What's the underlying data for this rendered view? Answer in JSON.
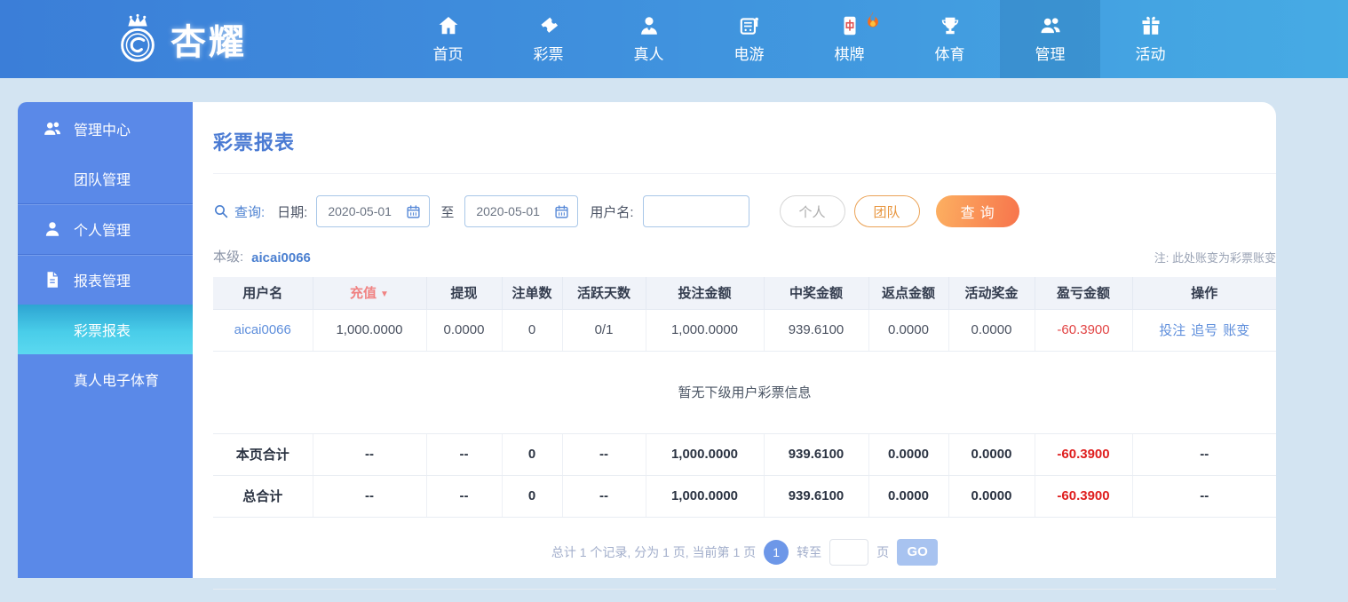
{
  "brand": {
    "name": "杏耀"
  },
  "nav": {
    "items": [
      {
        "id": "home",
        "label": "首页",
        "icon": "home-icon"
      },
      {
        "id": "lottery",
        "label": "彩票",
        "icon": "ticket-icon"
      },
      {
        "id": "live",
        "label": "真人",
        "icon": "dealer-icon"
      },
      {
        "id": "egames",
        "label": "电游",
        "icon": "slot-machine-icon"
      },
      {
        "id": "boardgames",
        "label": "棋牌",
        "icon": "mahjong-icon",
        "hot": true
      },
      {
        "id": "sports",
        "label": "体育",
        "icon": "trophy-icon"
      },
      {
        "id": "manage",
        "label": "管理",
        "icon": "group-icon",
        "active": true
      },
      {
        "id": "activity",
        "label": "活动",
        "icon": "gift-icon"
      }
    ]
  },
  "sidebar": {
    "items": [
      {
        "id": "manage-center",
        "label": "管理中心",
        "icon": "group-icon",
        "type": "parent"
      },
      {
        "id": "team-manage",
        "label": "团队管理",
        "type": "child"
      },
      {
        "id": "personal-manage",
        "label": "个人管理",
        "icon": "user-icon",
        "type": "parent",
        "divider": true
      },
      {
        "id": "report-manage",
        "label": "报表管理",
        "icon": "report-icon",
        "type": "parent",
        "divider": true
      },
      {
        "id": "lottery-report",
        "label": "彩票报表",
        "type": "child",
        "active": true
      },
      {
        "id": "live-esports",
        "label": "真人电子体育",
        "type": "child"
      }
    ]
  },
  "main": {
    "title": "彩票报表",
    "search": {
      "label": "查询:",
      "date_label": "日期:",
      "date_from": "2020-05-01",
      "to_label": "至",
      "date_to": "2020-05-01",
      "username_label": "用户名:",
      "username_value": "",
      "personal_button": "个人",
      "team_button": "团队",
      "query_button": "查询"
    },
    "level": {
      "label": "本级:",
      "value": "aicai0066"
    },
    "note": "注: 此处账变为彩票账变",
    "table": {
      "headers": [
        "用户名",
        "充值",
        "提现",
        "注单数",
        "活跃天数",
        "投注金额",
        "中奖金额",
        "返点金额",
        "活动奖金",
        "盈亏金额",
        "操作"
      ],
      "sort_arrow": "▼",
      "rows": [
        {
          "cells": [
            "aicai0066",
            "1,000.0000",
            "0.0000",
            "0",
            "0/1",
            "1,000.0000",
            "939.6100",
            "0.0000",
            "0.0000",
            "-60.3900"
          ],
          "actions": [
            "投注",
            "追号",
            "账变"
          ]
        }
      ],
      "empty_message": "暂无下级用户彩票信息",
      "page_total": {
        "cells": [
          "本页合计",
          "--",
          "--",
          "0",
          "--",
          "1,000.0000",
          "939.6100",
          "0.0000",
          "0.0000",
          "-60.3900",
          "--"
        ]
      },
      "grand_total": {
        "cells": [
          "总合计",
          "--",
          "--",
          "0",
          "--",
          "1,000.0000",
          "939.6100",
          "0.0000",
          "0.0000",
          "-60.3900",
          "--"
        ]
      }
    },
    "pagination": {
      "summary": "总计 1 个记录, 分为 1 页, 当前第 1 页",
      "current_page": "1",
      "goto_label": "转至",
      "page_label": "页",
      "go_button": "GO"
    }
  },
  "colors": {
    "nav_gradient_start": "#3b7ed8",
    "nav_gradient_end": "#46abe4",
    "sidebar_blue": "#5a89e8",
    "active_item_cyan": "#49cde9",
    "accent_blue": "#4a7fd0",
    "link_blue": "#5f8fdc",
    "query_orange": "#f7744c",
    "negative_red": "#e02b2b",
    "page_background": "#d3e4f2"
  }
}
